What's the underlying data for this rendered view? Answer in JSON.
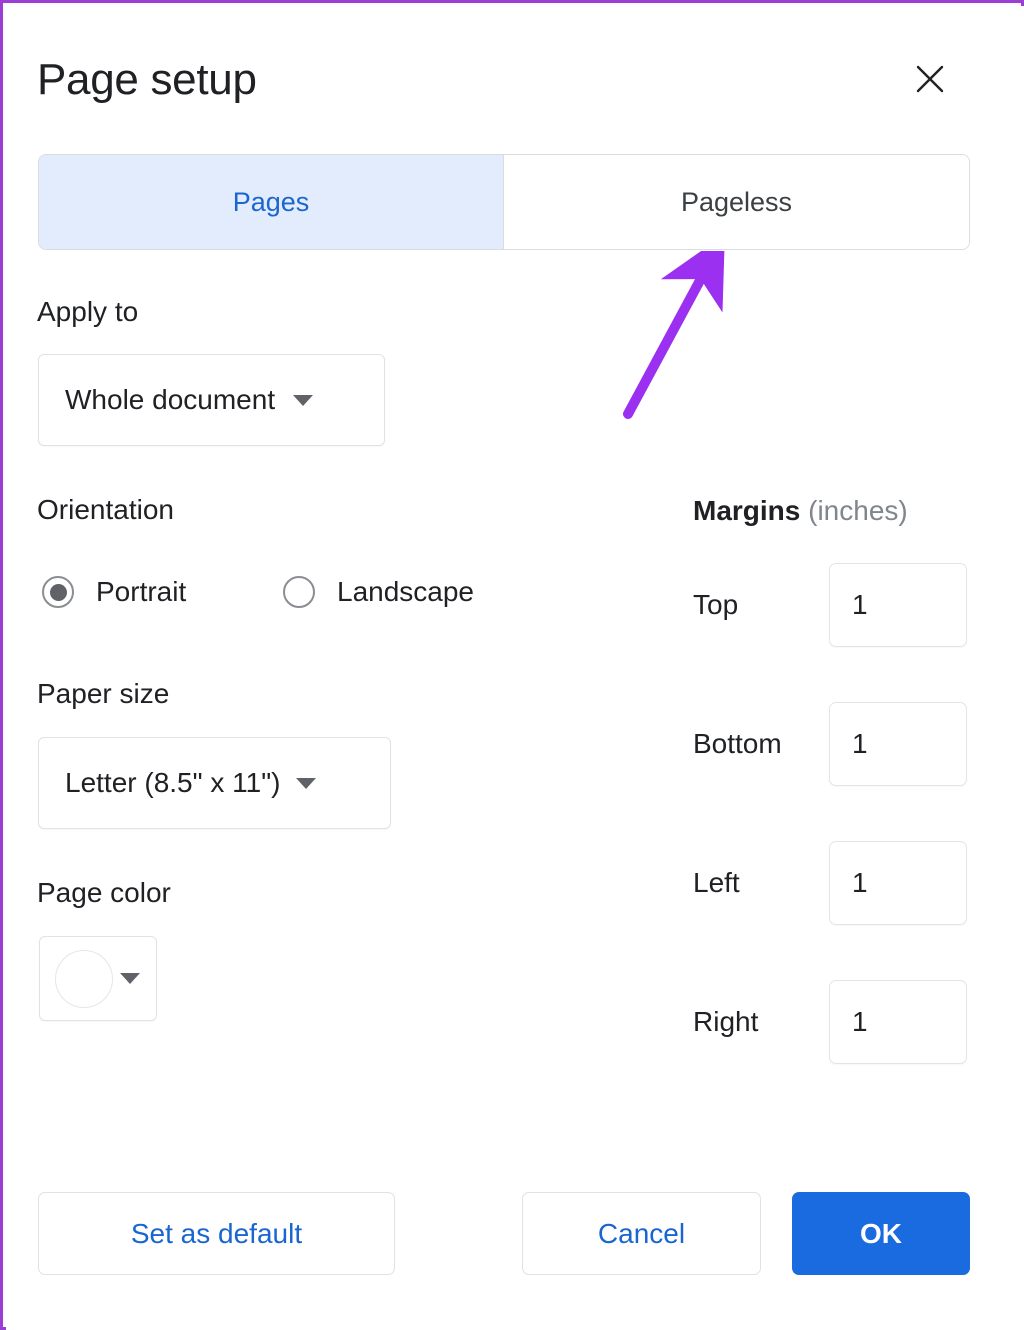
{
  "dialog": {
    "title": "Page setup",
    "close_icon": "close-icon"
  },
  "tabs": [
    {
      "label": "Pages",
      "active": true
    },
    {
      "label": "Pageless",
      "active": false
    }
  ],
  "apply_to": {
    "label": "Apply to",
    "value": "Whole document",
    "caret_icon": "chevron-down-icon"
  },
  "orientation": {
    "label": "Orientation",
    "options": [
      {
        "label": "Portrait",
        "selected": true
      },
      {
        "label": "Landscape",
        "selected": false
      }
    ]
  },
  "paper_size": {
    "label": "Paper size",
    "value": "Letter (8.5\" x 11\")",
    "caret_icon": "chevron-down-icon"
  },
  "page_color": {
    "label": "Page color",
    "swatch_color": "#ffffff",
    "caret_icon": "chevron-down-icon"
  },
  "margins": {
    "heading_strong": "Margins",
    "heading_weak": "(inches)",
    "fields": [
      {
        "label": "Top",
        "value": "1"
      },
      {
        "label": "Bottom",
        "value": "1"
      },
      {
        "label": "Left",
        "value": "1"
      },
      {
        "label": "Right",
        "value": "1"
      }
    ]
  },
  "footer": {
    "set_default_label": "Set as default",
    "cancel_label": "Cancel",
    "ok_label": "OK"
  },
  "annotation": {
    "arrow_color": "#9b30f0",
    "points_to": "Pageless"
  },
  "colors": {
    "frame": "#9b3fd4",
    "accent_blue": "#1a66d0",
    "primary_button": "#1a6ae0",
    "active_tab_bg": "#e3ecfd"
  }
}
